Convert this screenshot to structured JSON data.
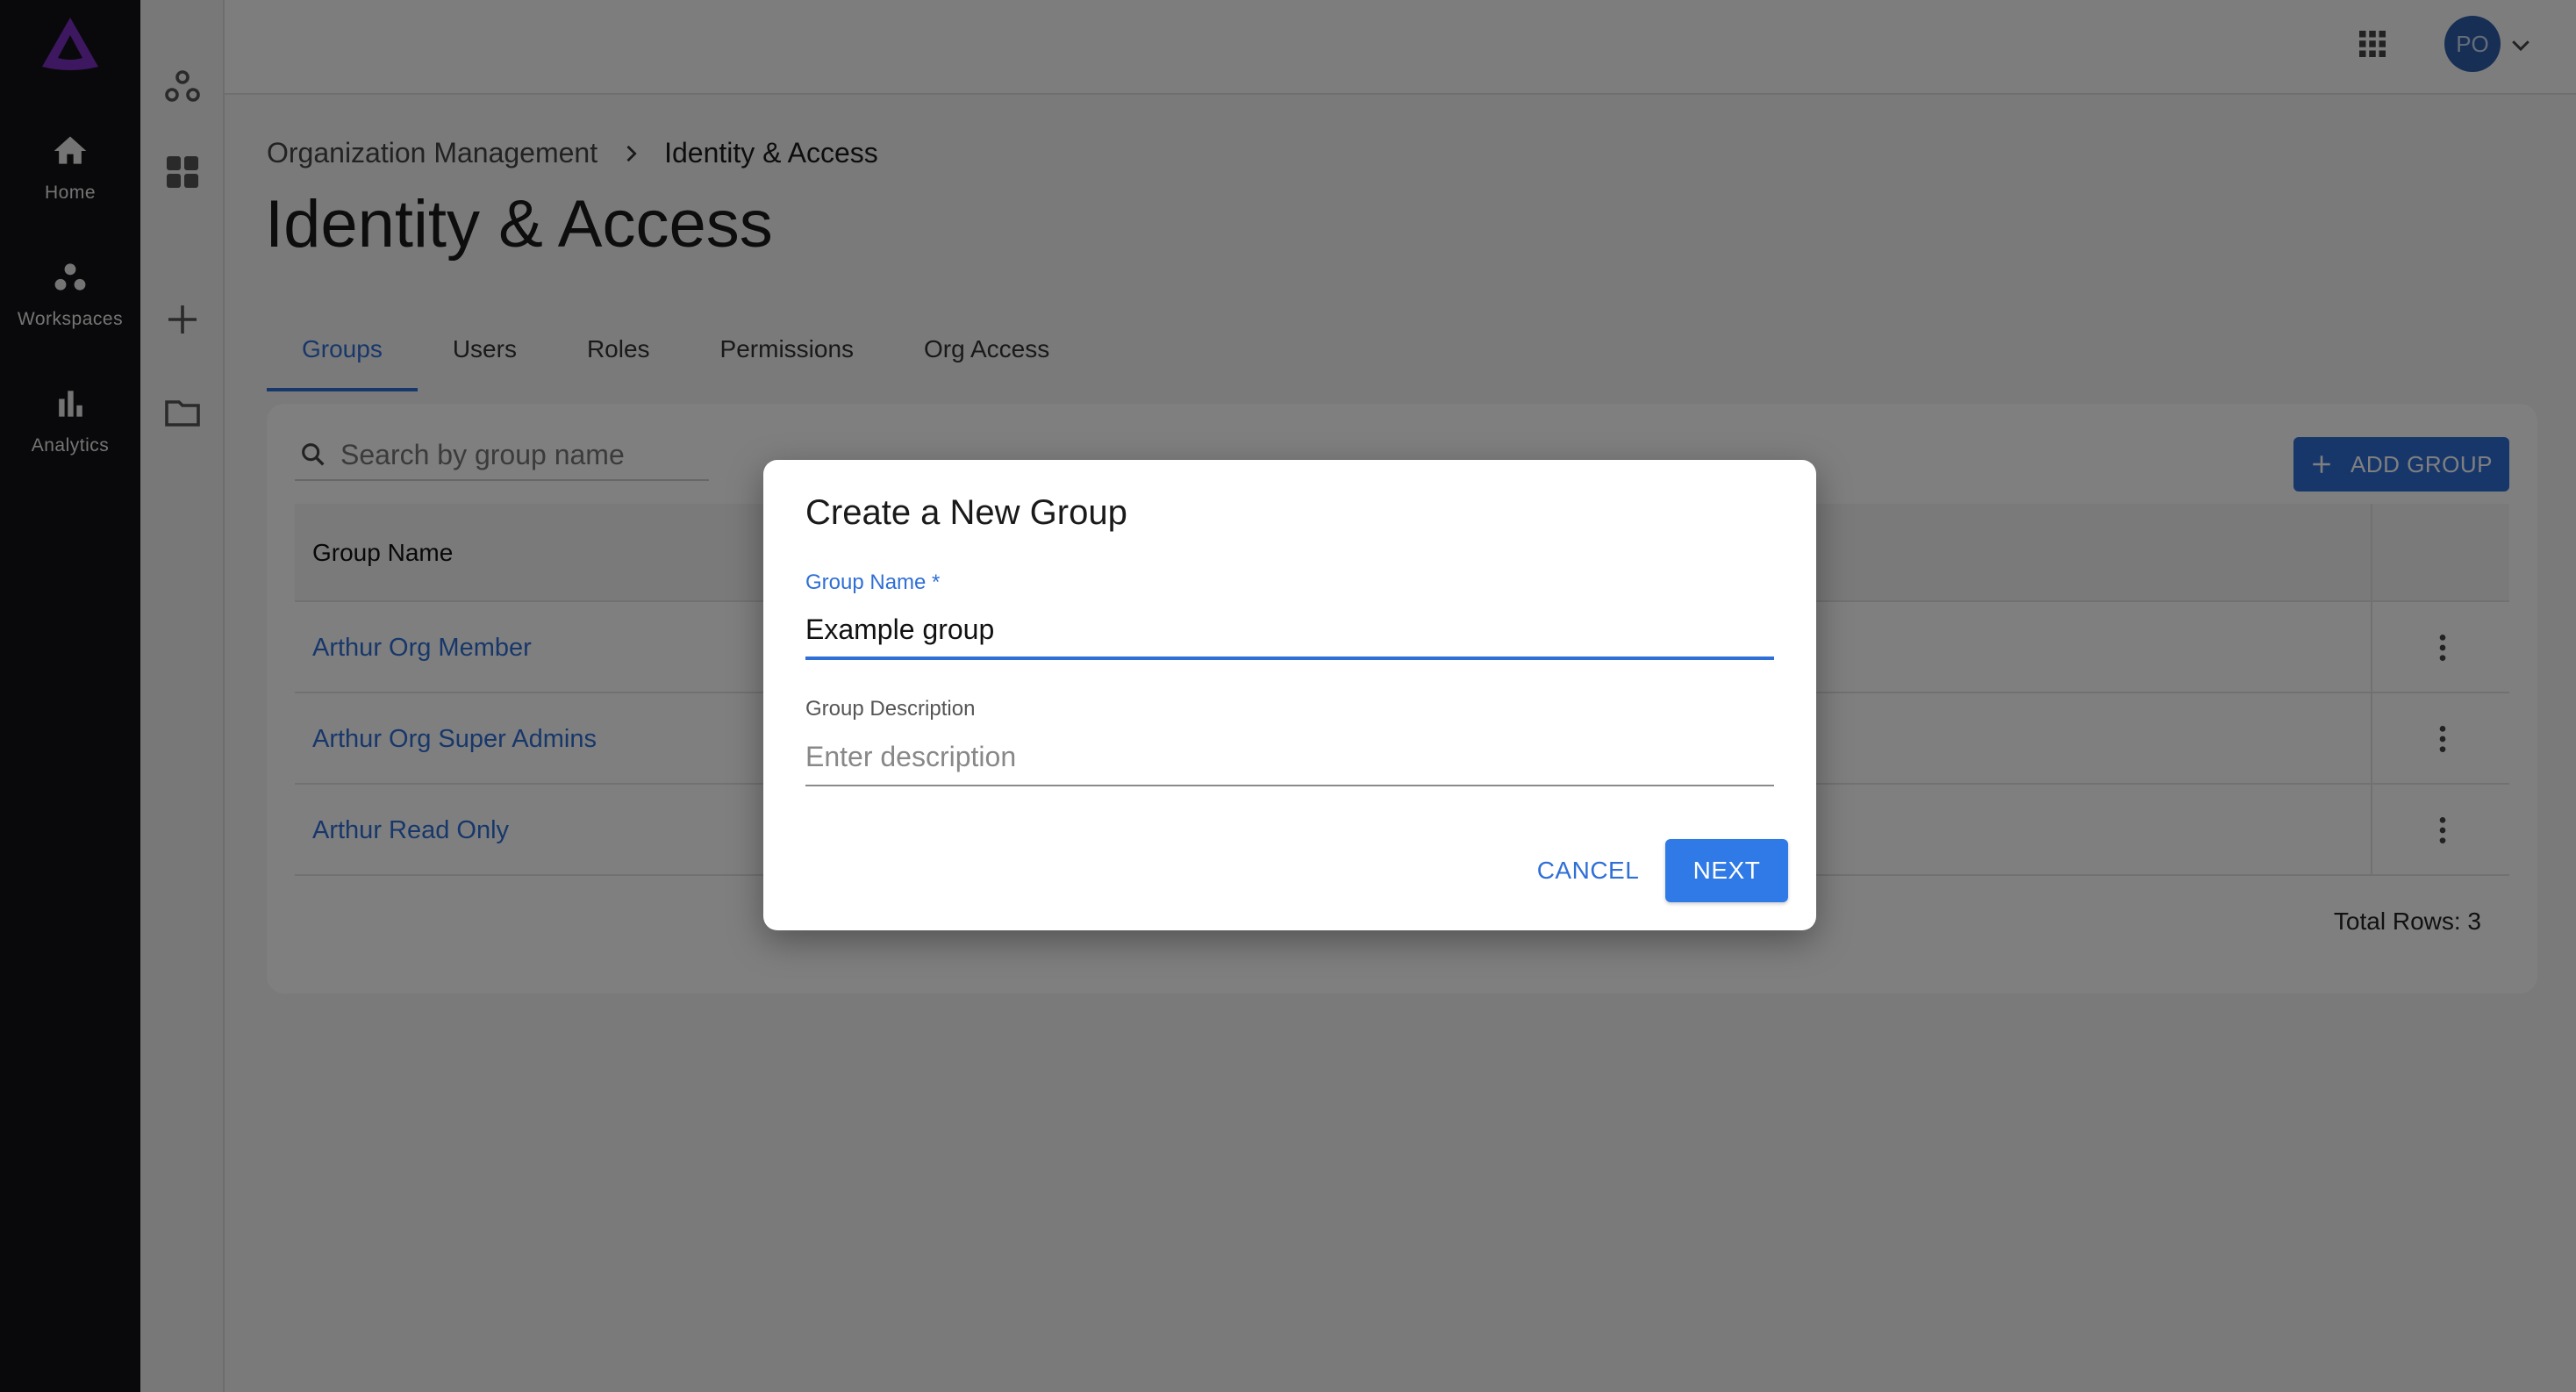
{
  "nav": {
    "items": [
      {
        "label": "Home"
      },
      {
        "label": "Workspaces"
      },
      {
        "label": "Analytics"
      }
    ]
  },
  "header": {
    "avatar_initials": "PO"
  },
  "breadcrumb": {
    "parent": "Organization Management",
    "current": "Identity & Access"
  },
  "page": {
    "title": "Identity & Access"
  },
  "tabs": [
    {
      "label": "Groups",
      "active": true
    },
    {
      "label": "Users"
    },
    {
      "label": "Roles"
    },
    {
      "label": "Permissions"
    },
    {
      "label": "Org Access"
    }
  ],
  "groups": {
    "search_placeholder": "Search by group name",
    "add_button_label": "ADD GROUP",
    "column_header": "Group Name",
    "rows": [
      {
        "name": "Arthur Org Member"
      },
      {
        "name": "Arthur Org Super Admins"
      },
      {
        "name": "Arthur Read Only"
      }
    ],
    "total_rows": "Total Rows: 3"
  },
  "dialog": {
    "title": "Create a New Group",
    "group_name_label": "Group Name *",
    "group_name_value": "Example group",
    "description_label": "Group Description",
    "description_placeholder": "Enter description",
    "cancel_label": "CANCEL",
    "next_label": "NEXT"
  },
  "colors": {
    "accent": "#2f6fd6",
    "brand": "#7b2fbe",
    "rail": "#121216"
  },
  "icons": [
    "logo-icon",
    "home-icon",
    "workspaces-icon",
    "analytics-icon",
    "apps-grid-icon",
    "chevron-down-icon",
    "chevron-right-icon",
    "search-icon",
    "plus-icon",
    "more-vert-icon",
    "folder-icon",
    "dashboard-icon"
  ]
}
